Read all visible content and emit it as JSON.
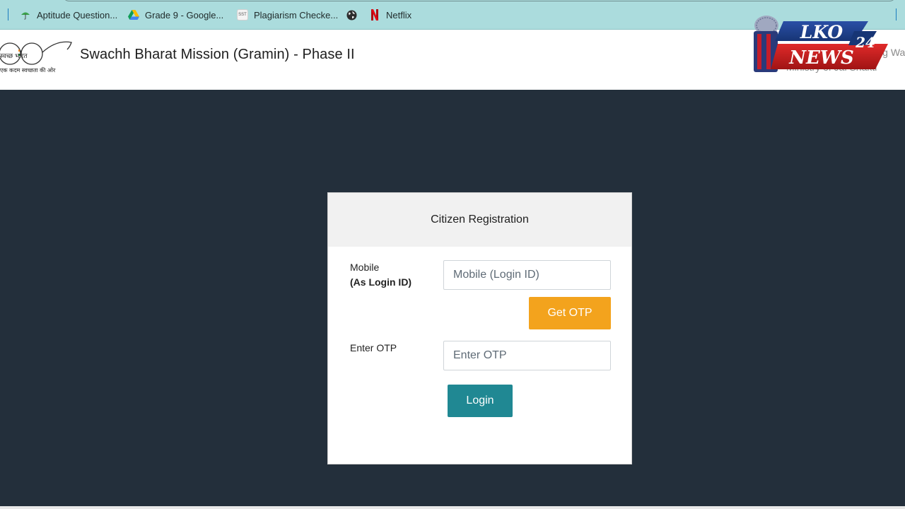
{
  "bookmarks": [
    {
      "label": "Aptitude Question...",
      "icon": "umbrella-icon"
    },
    {
      "label": "Grade 9 - Google...",
      "icon": "google-drive-icon"
    },
    {
      "label": "Plagiarism Checke...",
      "icon": "sst-icon",
      "icon_text": "SST"
    },
    {
      "label": "",
      "icon": "globe-icon"
    },
    {
      "label": "Netflix",
      "icon": "netflix-icon"
    }
  ],
  "header": {
    "logo_hindi_top": "स्वच्छ भारत",
    "logo_hindi_bottom": "एक कदम स्वच्छता की ओर",
    "title": "Swachh Bharat Mission (Gramin) - Phase II",
    "right_line1": "Department of Drinking Wa",
    "right_line2": "Ministry of Jal Shakti"
  },
  "watermark": {
    "line1": "LKO",
    "line2": "NEWS",
    "number": "24"
  },
  "form": {
    "title": "Citizen Registration",
    "mobile_label": "Mobile",
    "mobile_sublabel": "(As Login ID)",
    "mobile_placeholder": "Mobile (Login ID)",
    "get_otp_label": "Get OTP",
    "otp_label": "Enter OTP",
    "otp_placeholder": "Enter OTP",
    "login_label": "Login"
  },
  "colors": {
    "bookmarks_bg": "#abdcdd",
    "page_bg": "#232f3b",
    "otp_button": "#f3a31d",
    "login_button": "#208893"
  }
}
